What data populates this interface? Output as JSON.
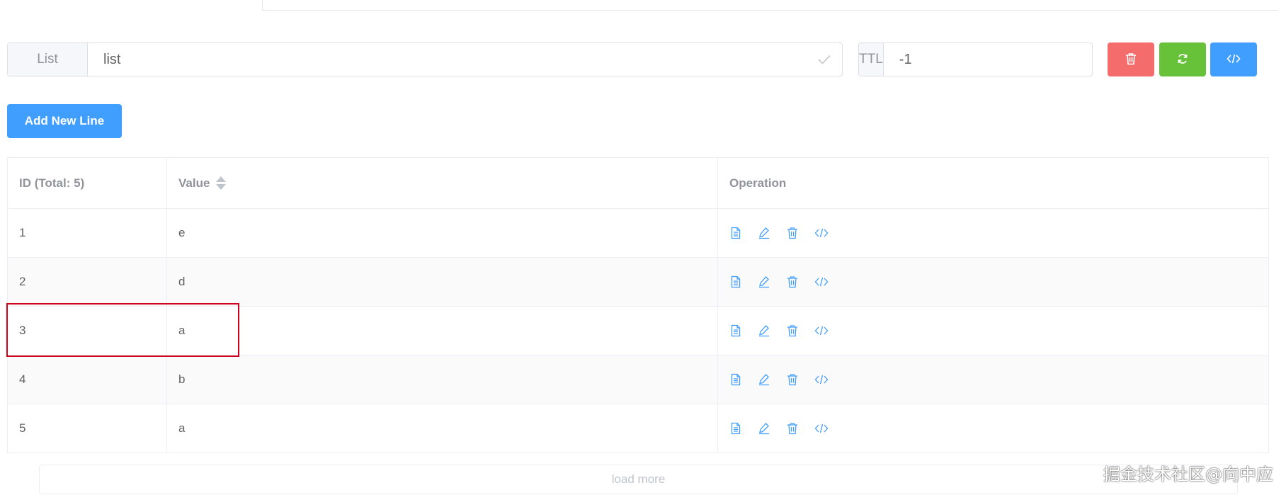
{
  "key": {
    "type_label": "List",
    "name": "list"
  },
  "ttl": {
    "label": "TTL",
    "value": "-1"
  },
  "actions": {
    "add_line_label": "Add New Line",
    "load_more_label": "load more"
  },
  "table": {
    "headers": {
      "id": "ID (Total: 5)",
      "value": "Value",
      "operation": "Operation"
    },
    "rows": [
      {
        "id": "1",
        "value": "e"
      },
      {
        "id": "2",
        "value": "d"
      },
      {
        "id": "3",
        "value": "a"
      },
      {
        "id": "4",
        "value": "b"
      },
      {
        "id": "5",
        "value": "a"
      }
    ]
  },
  "watermark": "掘金技术社区@向中应",
  "colors": {
    "primary": "#409eff",
    "danger": "#f56c6c",
    "success": "#67c23a",
    "highlight": "#d0021b"
  },
  "icons": {
    "operations": [
      "document-icon",
      "edit-icon",
      "trash-icon",
      "code-icon"
    ]
  }
}
